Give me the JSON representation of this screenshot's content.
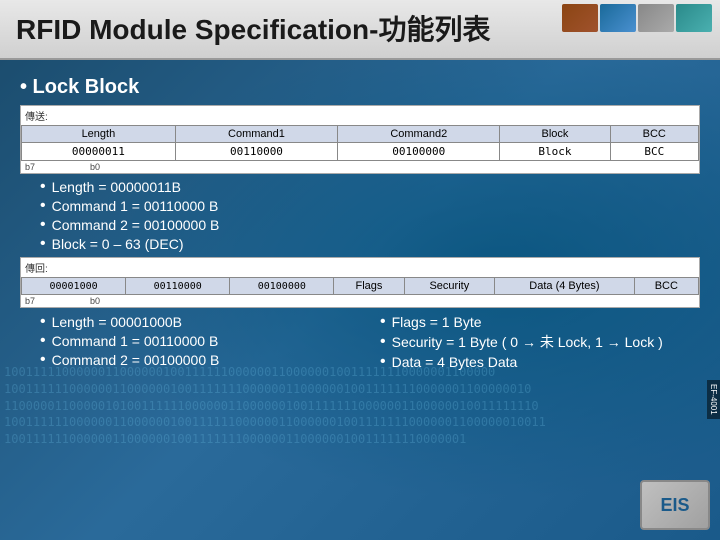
{
  "title": {
    "text": "RFID Module Specification-功能列表",
    "images": [
      "brown-chip",
      "blue-circuit",
      "gray-chip",
      "teal-circuit"
    ]
  },
  "section1": {
    "header": "• Lock Block",
    "table1": {
      "label": "傳送:",
      "headers": [
        "Length",
        "Command1",
        "Command2",
        "Block",
        "BCC"
      ],
      "row": [
        "00000011",
        "00110000",
        "00100000",
        "Block",
        "BCC"
      ],
      "row_label": "b7                b0"
    },
    "bullets": [
      "Length = 00000011B",
      "Command 1 = 00110000 B",
      "Command 2 = 00100000 B",
      "Block = 0 – 63 (DEC)"
    ]
  },
  "section2": {
    "table2": {
      "label": "傳回:",
      "headers": [
        "00001000",
        "00110000",
        "00100000",
        "Flags",
        "Security",
        "Data (4 Bytes)",
        "BCC"
      ],
      "row_label": "b7                b0"
    },
    "left_bullets": [
      "Length = 00001000B",
      "Command 1 = 00110000 B",
      "Command 2 = 00100000 B"
    ],
    "right_bullets": [
      "Flags = 1 Byte",
      "Security = 1 Byte ( 0 → 未 Lock, 1 → Lock )",
      "Data = 4 Bytes Data"
    ]
  },
  "binary_lines": [
    "10011111000000110000001001",
    "1001111110000001100000010011111110000001",
    "11000001100000101001111110000001100000",
    "1001111110000001100000010011111110000001"
  ],
  "logo": "EIS"
}
